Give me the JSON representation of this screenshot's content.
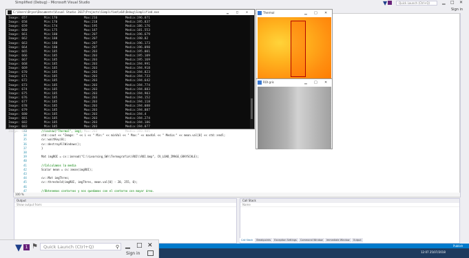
{
  "window": {
    "title": "Simplified (Debug) - Microsoft Visual Studio",
    "quick_launch": "Quick Launch (Ctrl+Q)",
    "sign_in": "Sign in",
    "minimize": "▁",
    "maximize": "□",
    "close": "✕"
  },
  "console": {
    "title": "C:\\Users\\Bryce\\Documents\\Visual Studio 2017\\Projects\\Simplified\\x64\\Debug\\Simplified.exe",
    "rows": [
      {
        "img": "Image: 657",
        "min": "Min:170",
        "max": "Max:216",
        "media": "Media:196.071"
      },
      {
        "img": "Image: 658",
        "min": "Min:170",
        "max": "Max:218",
        "media": "Media:195.837"
      },
      {
        "img": "Image: 659",
        "min": "Min:174",
        "max": "Max:195",
        "media": "Media:186.176"
      },
      {
        "img": "Image: 660",
        "min": "Min:175",
        "max": "Max:187",
        "media": "Media:181.553"
      },
      {
        "img": "Image: 661",
        "min": "Min:180",
        "max": "Max:207",
        "media": "Media:196.679"
      },
      {
        "img": "Image: 662",
        "min": "Min:188",
        "max": "Max:207",
        "media": "Media:198.82"
      },
      {
        "img": "Image: 663",
        "min": "Min:180",
        "max": "Max:207",
        "media": "Media:196.173"
      },
      {
        "img": "Image: 664",
        "min": "Min:180",
        "max": "Max:207",
        "media": "Media:196.098"
      },
      {
        "img": "Image: 665",
        "min": "Min:185",
        "max": "Max:203",
        "media": "Media:195.001"
      },
      {
        "img": "Image: 666",
        "min": "Min:185",
        "max": "Max:203",
        "media": "Media:195.109"
      },
      {
        "img": "Image: 667",
        "min": "Min:185",
        "max": "Max:203",
        "media": "Media:195.169"
      },
      {
        "img": "Image: 668",
        "min": "Min:185",
        "max": "Max:203",
        "media": "Media:194.991"
      },
      {
        "img": "Image: 669",
        "min": "Min:185",
        "max": "Max:203",
        "media": "Media:194.918"
      },
      {
        "img": "Image: 670",
        "min": "Min:185",
        "max": "Max:203",
        "media": "Media:194.823"
      },
      {
        "img": "Image: 671",
        "min": "Min:185",
        "max": "Max:203",
        "media": "Media:194.733"
      },
      {
        "img": "Image: 672",
        "min": "Min:185",
        "max": "Max:203",
        "media": "Media:194.642"
      },
      {
        "img": "Image: 673",
        "min": "Min:185",
        "max": "Max:203",
        "media": "Media:194.774"
      },
      {
        "img": "Image: 674",
        "min": "Min:185",
        "max": "Max:203",
        "media": "Media:194.883"
      },
      {
        "img": "Image: 675",
        "min": "Min:185",
        "max": "Max:203",
        "media": "Media:194.903"
      },
      {
        "img": "Image: 676",
        "min": "Min:185",
        "max": "Max:203",
        "media": "Media:194.152"
      },
      {
        "img": "Image: 677",
        "min": "Min:185",
        "max": "Max:203",
        "media": "Media:194.118"
      },
      {
        "img": "Image: 678",
        "min": "Min:185",
        "max": "Max:203",
        "media": "Media:194.088"
      },
      {
        "img": "Image: 679",
        "min": "Min:185",
        "max": "Max:203",
        "media": "Media:194.887"
      },
      {
        "img": "Image: 680",
        "min": "Min:185",
        "max": "Max:203",
        "media": "Media:194.4"
      },
      {
        "img": "Image: 681",
        "min": "Min:185",
        "max": "Max:203",
        "media": "Media:194.274"
      },
      {
        "img": "Image: 682",
        "min": "Min:185",
        "max": "Max:203",
        "media": "Media:194.186"
      },
      {
        "img": "Image: 683",
        "min": "Min:185",
        "max": "Max:203",
        "media": "Media:194.077"
      },
      {
        "img": "Image: 684",
        "min": "Min:185",
        "max": "Max:203",
        "media": "Media:193.985"
      }
    ]
  },
  "image_windows": {
    "thermal_title": "Thermal",
    "gray_title": "ROI gris"
  },
  "editor": {
    "line_numbers": [
      "33",
      "34",
      "35",
      "36",
      "37",
      "38",
      "39",
      "40",
      "41",
      "42",
      "43",
      "44",
      "45",
      "46",
      "47",
      "48",
      "49"
    ],
    "lines": [
      "            //imshow(\"Thermal\", img);",
      "            std::cout << \"Image: \" << i << \"  Min:\" << minVal << \"  Max:\" << maxVal << \"  Media:\" << mean.val[0] << std::endl;",
      "            cv::waitKey(0);",
      "            cv::destroyAllWindows();",
      "        }",
      "",
      "        Mat imgROI = cv::imread(\"C:\\\\Learning_SW\\\\Termografia\\\\ROI\\\\ROI.bmp\", CV_LOAD_IMAGE_GRAYSCALE);",
      "",
      "        //Calculamos la media",
      "        Scalar mean = cv::mean(imgROI);",
      "",
      "        cv::Mat imgThres;",
      "        cv::threshold(imgROI, imgThres, mean.val[0] - 20, 255, 0);",
      "",
      "        //Obtenemos contornos y nos quedamos con el contorno con mayor área."
    ],
    "zoom_level": "100 %"
  },
  "panels": {
    "output_title": "Output",
    "output_sub": "Show output from:",
    "callstack_title": "Call Stack",
    "callstack_sub": "Name",
    "tabs": [
      "Call Stack",
      "Breakpoints",
      "Exception Settings",
      "Command Window",
      "Immediate Window",
      "Output"
    ]
  },
  "statusbar": {
    "left": "Ready",
    "right": "Publish"
  },
  "tray": {
    "time": "12:07",
    "date": "25/07/2018"
  },
  "colors": {
    "accent": "#007acc",
    "badge": "#68217a"
  }
}
